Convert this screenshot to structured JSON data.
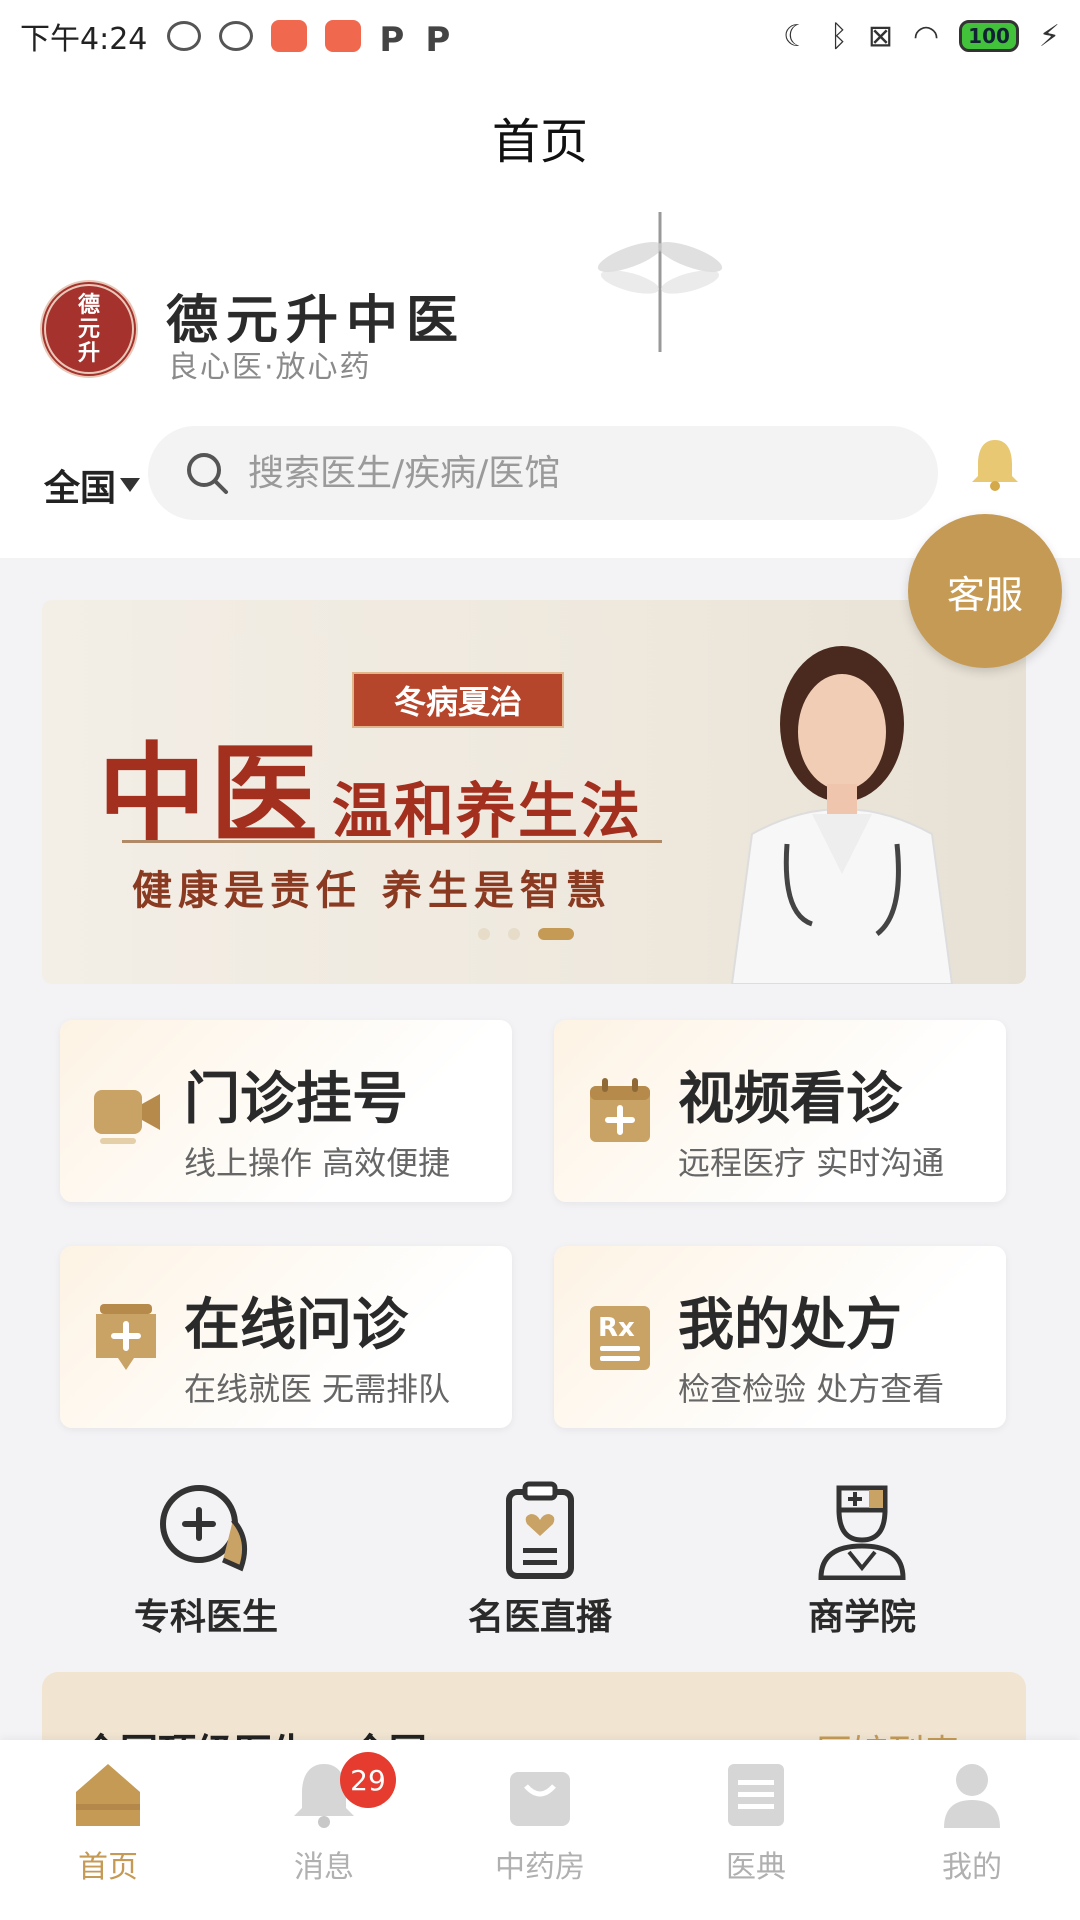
{
  "status_bar": {
    "time": "下午4:24",
    "battery": "100"
  },
  "header": {
    "title": "首页"
  },
  "brand": {
    "name": "德元升中医",
    "slogan": "良心医·放心药",
    "logo_text": "德元升"
  },
  "search": {
    "region": "全国",
    "placeholder": "搜索医生/疾病/医馆"
  },
  "service": {
    "label": "客服"
  },
  "banner": {
    "tag": "冬病夏治",
    "title_big": "中医",
    "title_small": "温和养生法",
    "subtitle": "健康是责任  养生是智慧",
    "slide_count": 3,
    "active_slide": 3
  },
  "cards": [
    {
      "title": "门诊挂号",
      "subtitle": "线上操作 高效便捷",
      "icon": "video-camera-icon"
    },
    {
      "title": "视频看诊",
      "subtitle": "远程医疗 实时沟通",
      "icon": "calendar-plus-icon"
    },
    {
      "title": "在线问诊",
      "subtitle": "在线就医 无需排队",
      "icon": "medical-chat-icon"
    },
    {
      "title": "我的处方",
      "subtitle": "检查检验 处方查看",
      "icon": "prescription-icon"
    }
  ],
  "quick_links": [
    {
      "label": "专科医生",
      "icon": "chat-plus-icon"
    },
    {
      "label": "名医直播",
      "icon": "clipboard-heart-icon"
    },
    {
      "label": "商学院",
      "icon": "nurse-icon"
    }
  ],
  "section_peek": {
    "left": "全国顶级医生 · 全国",
    "right": "医馆列表 ›"
  },
  "tabbar": [
    {
      "label": "首页",
      "icon": "home-icon",
      "active": true
    },
    {
      "label": "消息",
      "icon": "bell-icon",
      "badge": "29"
    },
    {
      "label": "中药房",
      "icon": "shopping-bag-icon"
    },
    {
      "label": "医典",
      "icon": "book-icon"
    },
    {
      "label": "我的",
      "icon": "user-icon"
    }
  ],
  "colors": {
    "accent": "#c49a55",
    "brand_red": "#a3301f",
    "badge": "#e53c2f"
  }
}
